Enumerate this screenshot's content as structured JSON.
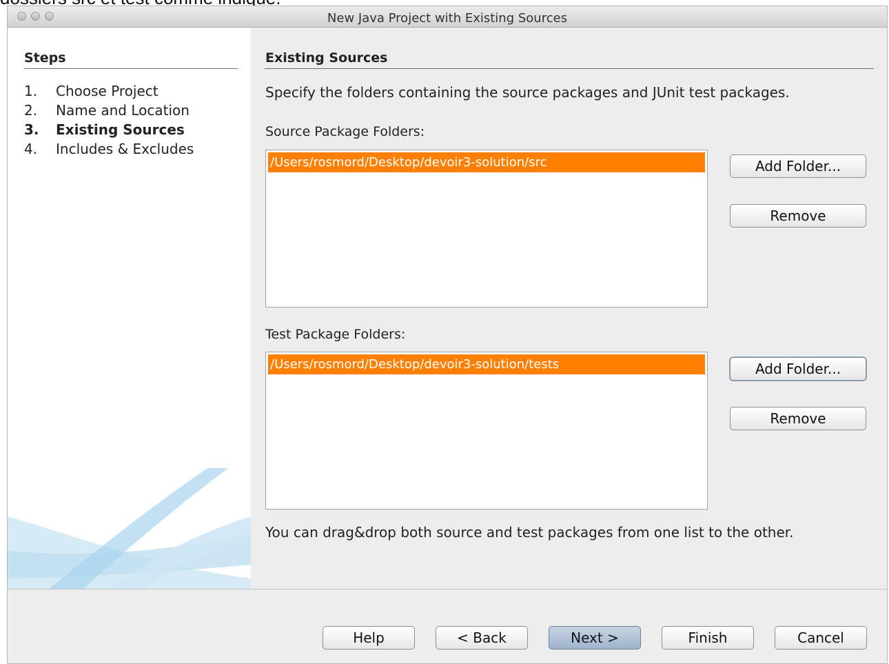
{
  "background_caption": "dossiers src et test comme indiqué.",
  "window": {
    "title": "New Java Project with Existing Sources"
  },
  "steps": {
    "title": "Steps",
    "items": [
      {
        "num": "1.",
        "label": "Choose Project",
        "active": false
      },
      {
        "num": "2.",
        "label": "Name and Location",
        "active": false
      },
      {
        "num": "3.",
        "label": "Existing Sources",
        "active": true
      },
      {
        "num": "4.",
        "label": "Includes & Excludes",
        "active": false
      }
    ]
  },
  "panel": {
    "title": "Existing Sources",
    "description": "Specify the folders containing the source packages and JUnit test packages.",
    "source": {
      "label": "Source Package Folders:",
      "items": [
        "/Users/rosmord/Desktop/devoir3-solution/src"
      ],
      "add_label": "Add Folder...",
      "remove_label": "Remove"
    },
    "test": {
      "label": "Test Package Folders:",
      "items": [
        "/Users/rosmord/Desktop/devoir3-solution/tests"
      ],
      "add_label": "Add Folder...",
      "remove_label": "Remove"
    },
    "tip": "You can drag&drop both source and test packages from one list to the other."
  },
  "footer": {
    "help": "Help",
    "back": "< Back",
    "next": "Next >",
    "finish": "Finish",
    "cancel": "Cancel"
  },
  "colors": {
    "selection": "#ff8000",
    "primary_button": "#a9bbd2"
  }
}
